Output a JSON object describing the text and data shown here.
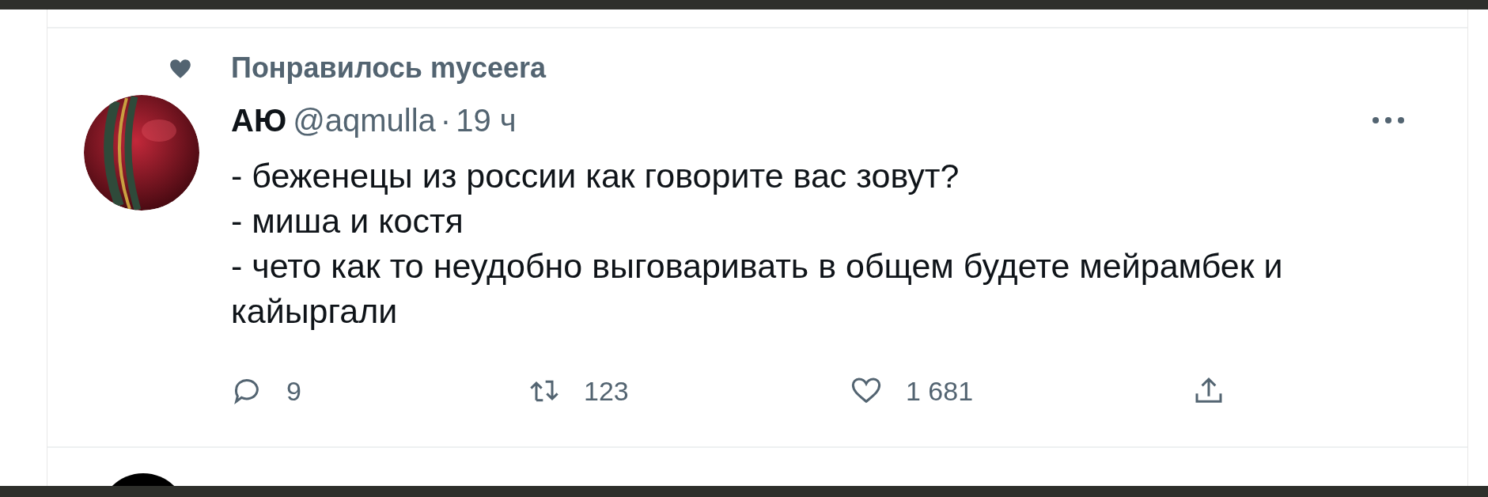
{
  "tweet": {
    "liked_by": "Понравилось myceera",
    "name": "АЮ",
    "handle": "@aqmulla",
    "separator": "·",
    "time": "19 ч",
    "text_lines": [
      "- беженецы из россии как говорите вас зовут?",
      "- миша и костя",
      "- чето как то неудобно выговаривать в общем будете мейрамбек и кайыргали"
    ],
    "actions": [
      {
        "kind": "reply",
        "count": "9"
      },
      {
        "kind": "retweet",
        "count": "123"
      },
      {
        "kind": "like",
        "count": "1 681"
      },
      {
        "kind": "share"
      }
    ]
  }
}
